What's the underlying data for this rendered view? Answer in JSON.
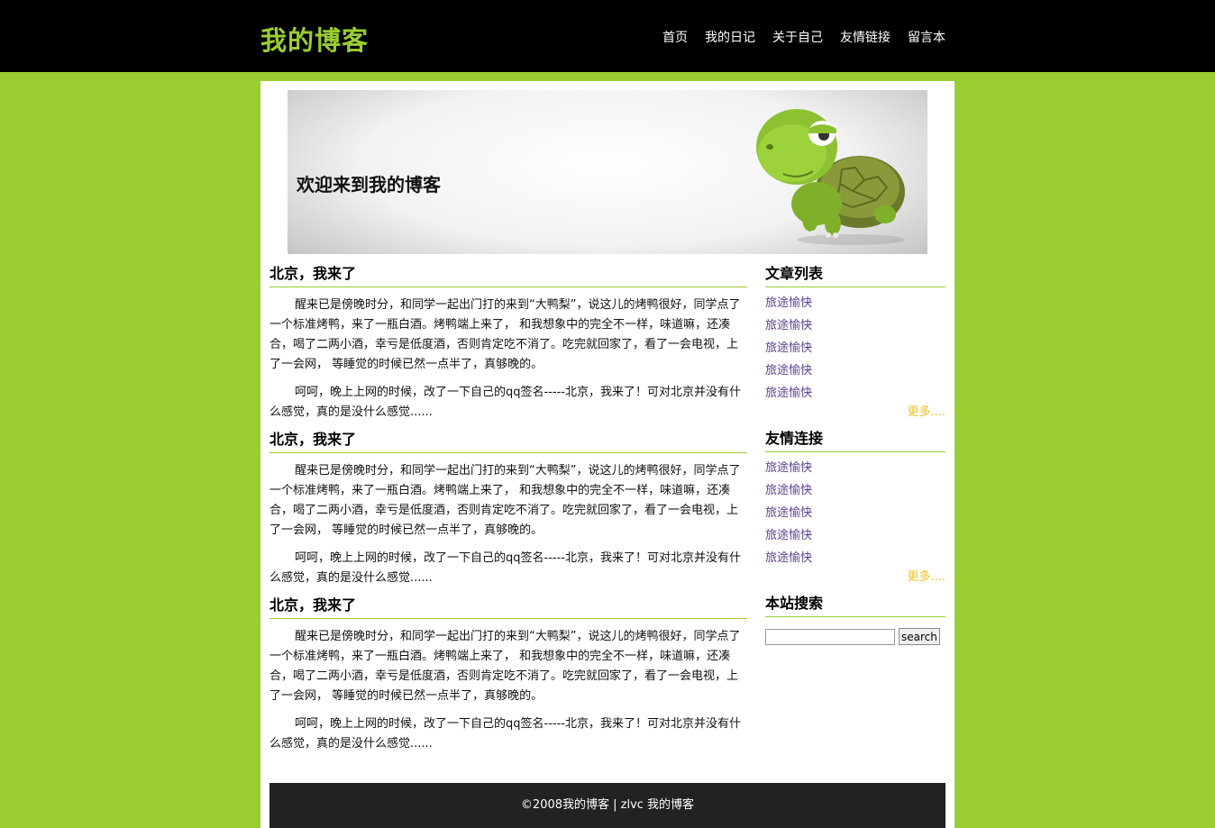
{
  "header": {
    "logo": "我的博客",
    "nav": [
      "首页",
      "我的日记",
      "关于自己",
      "友情链接",
      "留言本"
    ]
  },
  "banner": {
    "title": "欢迎来到我的博客",
    "image": "turtle-illustration"
  },
  "articles": [
    {
      "title": "北京，我来了",
      "p1": "醒来已是傍晚时分，和同学一起出门打的来到“大鸭梨”，说这儿的烤鸭很好，同学点了一个标准烤鸭，来了一瓶白酒。烤鸭端上来了， 和我想象中的完全不一样，味道嘛，还凑合，喝了二两小酒，幸亏是低度酒，否则肯定吃不消了。吃完就回家了，看了一会电视，上了一会网， 等睡觉的时候已然一点半了，真够晚的。",
      "p2": "呵呵，晚上上网的时候，改了一下自己的qq签名-----北京，我来了！可对北京并没有什么感觉，真的是没什么感觉......"
    },
    {
      "title": "北京，我来了",
      "p1": "醒来已是傍晚时分，和同学一起出门打的来到“大鸭梨”，说这儿的烤鸭很好，同学点了一个标准烤鸭，来了一瓶白酒。烤鸭端上来了， 和我想象中的完全不一样，味道嘛，还凑合，喝了二两小酒，幸亏是低度酒，否则肯定吃不消了。吃完就回家了，看了一会电视，上了一会网， 等睡觉的时候已然一点半了，真够晚的。",
      "p2": "呵呵，晚上上网的时候，改了一下自己的qq签名-----北京，我来了！可对北京并没有什么感觉，真的是没什么感觉......"
    },
    {
      "title": "北京，我来了",
      "p1": "醒来已是傍晚时分，和同学一起出门打的来到“大鸭梨”，说这儿的烤鸭很好，同学点了一个标准烤鸭，来了一瓶白酒。烤鸭端上来了， 和我想象中的完全不一样，味道嘛，还凑合，喝了二两小酒，幸亏是低度酒，否则肯定吃不消了。吃完就回家了，看了一会电视，上了一会网， 等睡觉的时候已然一点半了，真够晚的。",
      "p2": "呵呵，晚上上网的时候，改了一下自己的qq签名-----北京，我来了！可对北京并没有什么感觉，真的是没什么感觉......"
    }
  ],
  "sidebar": {
    "articles": {
      "heading": "文章列表",
      "items": [
        "旅途愉快",
        "旅途愉快",
        "旅途愉快",
        "旅途愉快",
        "旅途愉快"
      ],
      "more": "更多...."
    },
    "links": {
      "heading": "友情连接",
      "items": [
        "旅途愉快",
        "旅途愉快",
        "旅途愉快",
        "旅途愉快",
        "旅途愉快"
      ],
      "more": "更多...."
    },
    "search": {
      "heading": "本站搜索",
      "value": "",
      "button": "search"
    }
  },
  "footer": {
    "text": "©2008我的博客 | zlvc 我的博客"
  },
  "colors": {
    "accent": "#9acd32",
    "topbar": "#000000",
    "footer": "#222222",
    "link": "#5b3f8c",
    "more": "#f0c020"
  }
}
